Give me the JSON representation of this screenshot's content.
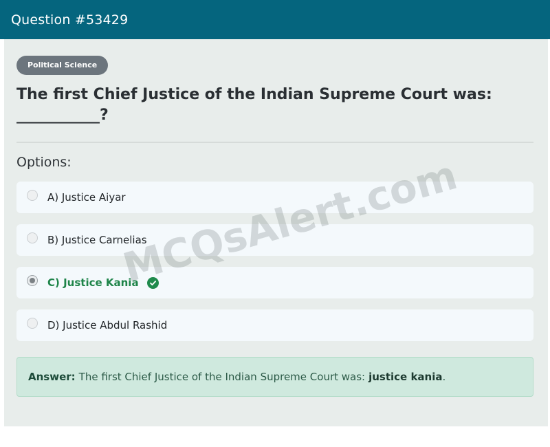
{
  "header": {
    "title": "Question #53429"
  },
  "question": {
    "category": "Political Science",
    "text": "The first Chief Justice of the Indian Supreme Court was: ___________?"
  },
  "options_label": "Options:",
  "options": [
    {
      "label": "A) Justice Aiyar",
      "selected": false,
      "correct": false
    },
    {
      "label": "B) Justice Carnelias",
      "selected": false,
      "correct": false
    },
    {
      "label": "C) Justice Kania",
      "selected": true,
      "correct": true
    },
    {
      "label": "D) Justice Abdul Rashid",
      "selected": false,
      "correct": false
    }
  ],
  "answer": {
    "label": "Answer:",
    "text": "The first Chief Justice of the Indian Supreme Court was:",
    "value": "justice kania",
    "suffix": "."
  },
  "watermark": "MCQsAlert.com",
  "colors": {
    "header": "#05657e",
    "correct": "#1e8449",
    "answer_bg": "#cfe9de",
    "badge": "#6c757d"
  },
  "icons": {
    "correct": "check-circle-icon"
  }
}
